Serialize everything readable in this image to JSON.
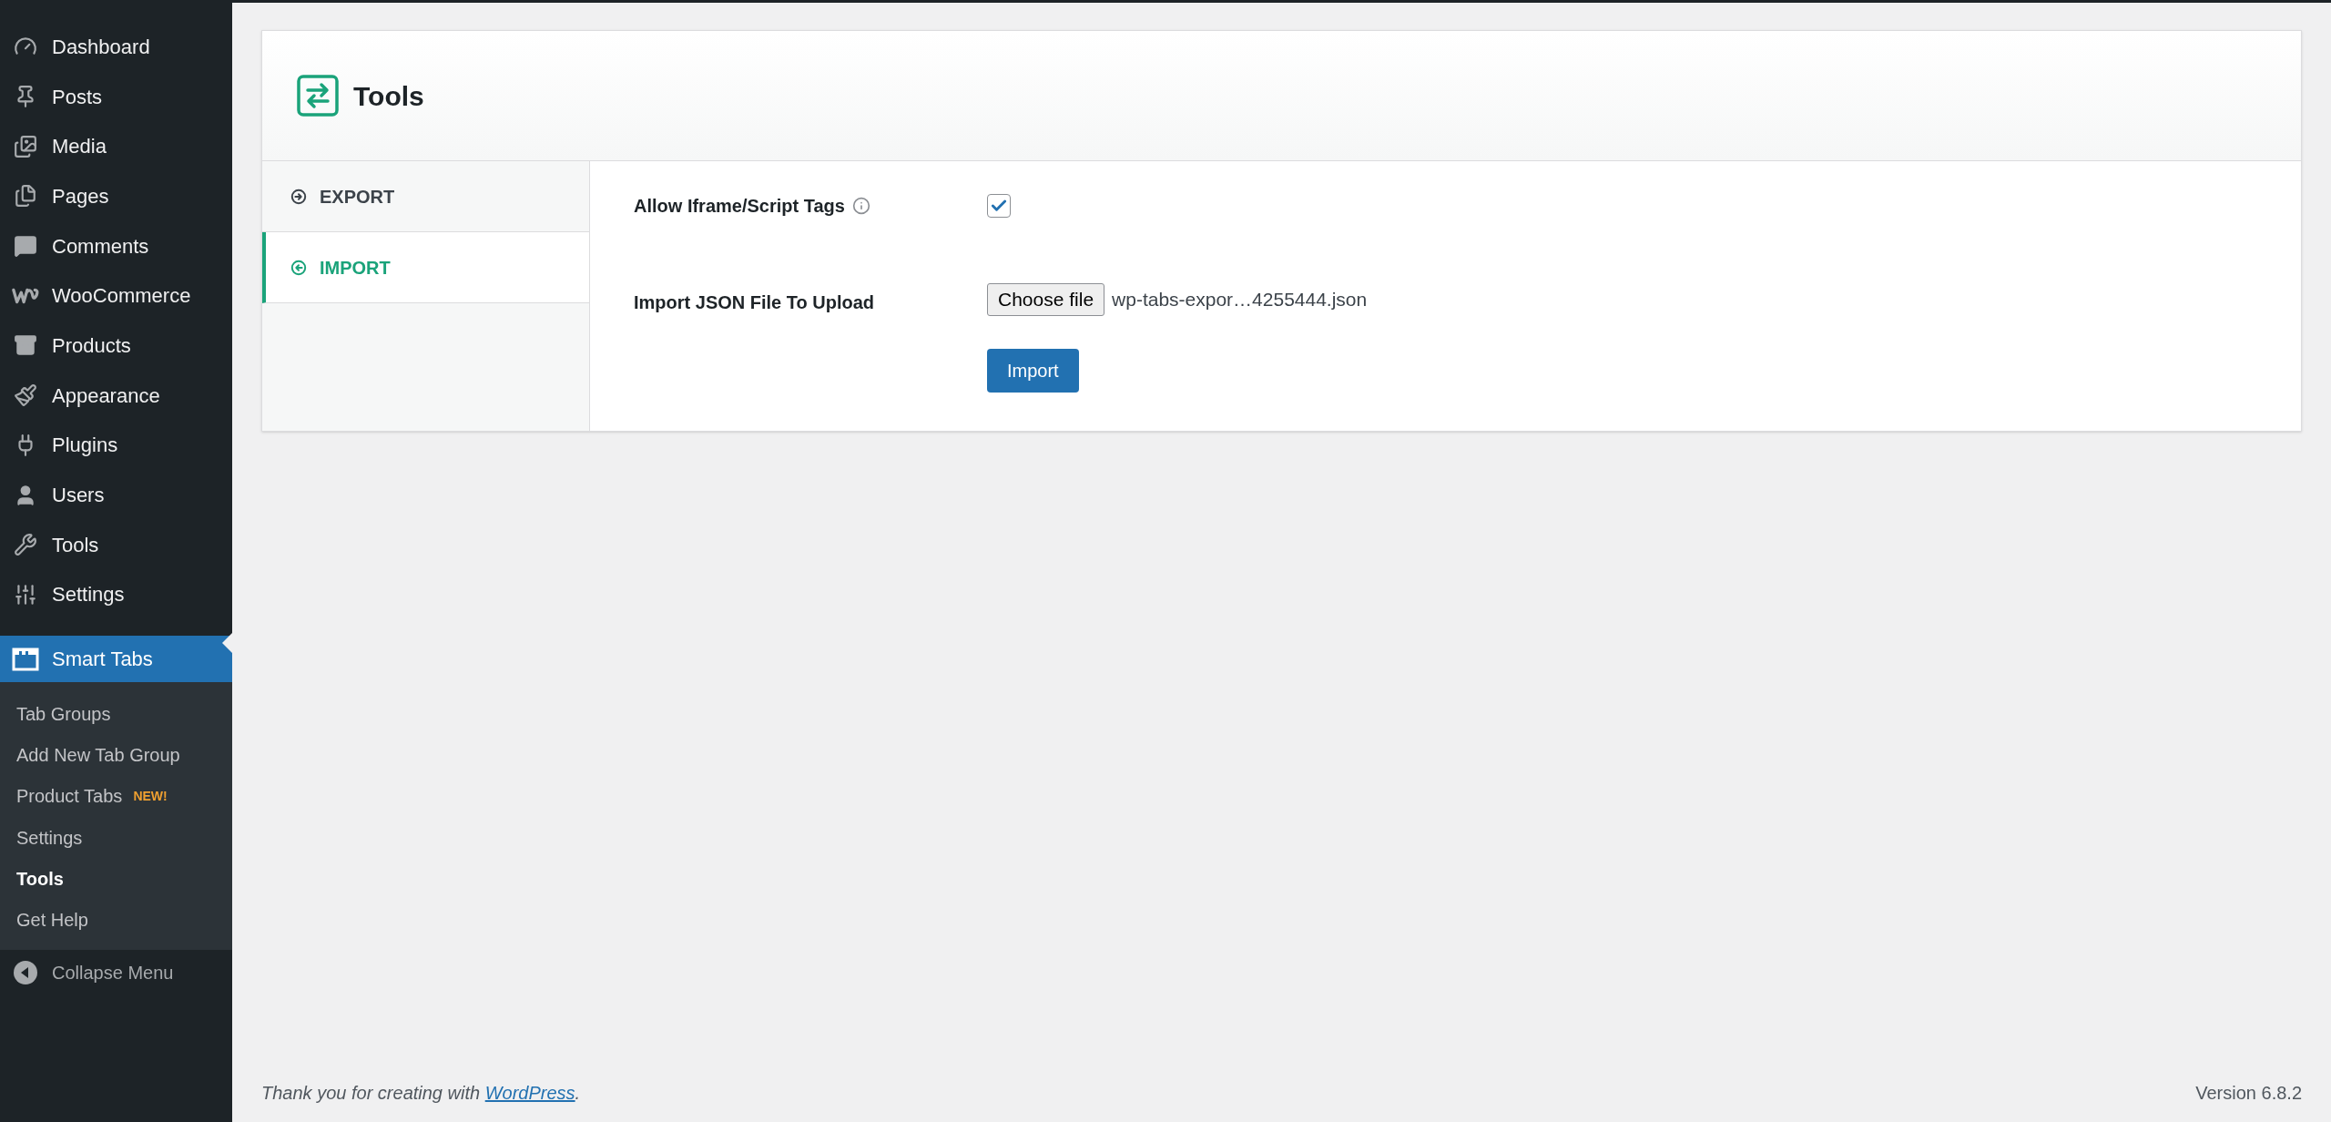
{
  "sidebar": {
    "menu": [
      {
        "label": "Dashboard",
        "selected": false
      },
      {
        "label": "Posts",
        "selected": false
      },
      {
        "label": "Media",
        "selected": false
      },
      {
        "label": "Pages",
        "selected": false
      },
      {
        "label": "Comments",
        "selected": false
      },
      {
        "label": "WooCommerce",
        "selected": false
      },
      {
        "label": "Products",
        "selected": false
      },
      {
        "label": "Appearance",
        "selected": false
      },
      {
        "label": "Plugins",
        "selected": false
      },
      {
        "label": "Users",
        "selected": false
      },
      {
        "label": "Tools",
        "selected": false
      },
      {
        "label": "Settings",
        "selected": false
      },
      {
        "label": "Smart Tabs",
        "selected": true
      }
    ],
    "submenu": [
      {
        "label": "Tab Groups",
        "selected": false
      },
      {
        "label": "Add New Tab Group",
        "selected": false
      },
      {
        "label": "Product Tabs",
        "badge": "NEW!",
        "selected": false
      },
      {
        "label": "Settings",
        "selected": false
      },
      {
        "label": "Tools",
        "selected": true
      },
      {
        "label": "Get Help",
        "selected": false
      }
    ],
    "collapse": "Collapse Menu"
  },
  "page": {
    "title": "Tools"
  },
  "tabs": [
    {
      "label": "EXPORT",
      "selected": false
    },
    {
      "label": "IMPORT",
      "selected": true
    }
  ],
  "settings": {
    "allow_tags": {
      "label": "Allow Iframe/Script Tags",
      "checked": true
    },
    "import_file": {
      "label": "Import JSON File To Upload",
      "button": "Choose file",
      "filename": "wp-tabs-expor…4255444.json"
    },
    "submit": "Import"
  },
  "footer": {
    "thanks": "Thank you for creating with ",
    "link": "WordPress",
    "after": ".",
    "version": "Version 6.8.2"
  }
}
